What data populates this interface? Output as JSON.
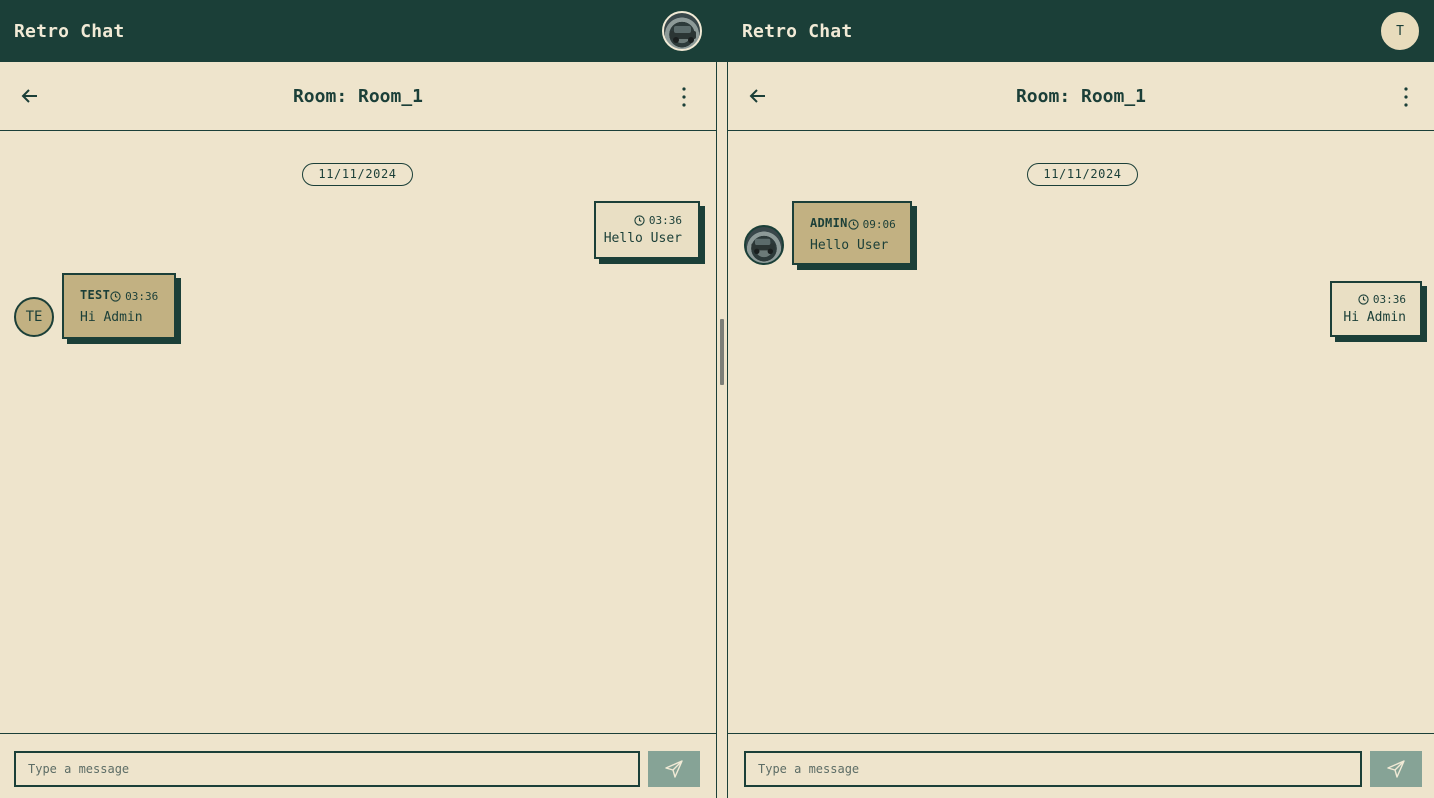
{
  "app": {
    "title": "Retro Chat"
  },
  "left_pane": {
    "header": {
      "title": "Retro Chat",
      "avatar": "user-photo-avatar"
    },
    "room": {
      "title": "Room: Room_1"
    },
    "date_label": "11/11/2024",
    "messages": [
      {
        "direction": "outgoing",
        "sender": "",
        "time": "03:36",
        "text": "Hello User"
      },
      {
        "direction": "incoming",
        "sender": "TEST",
        "avatar_initials": "TE",
        "time": "03:36",
        "text": "Hi Admin"
      }
    ],
    "composer": {
      "placeholder": "Type a message",
      "value": ""
    }
  },
  "right_pane": {
    "header": {
      "title": "Retro Chat",
      "avatar_initial": "T"
    },
    "room": {
      "title": "Room: Room_1"
    },
    "date_label": "11/11/2024",
    "messages": [
      {
        "direction": "incoming",
        "sender": "ADMIN",
        "avatar": "user-photo-avatar",
        "time": "09:06",
        "text": "Hello User"
      },
      {
        "direction": "outgoing",
        "sender": "",
        "time": "03:36",
        "text": "Hi Admin"
      }
    ],
    "composer": {
      "placeholder": "Type a message",
      "value": ""
    }
  },
  "colors": {
    "header_bg": "#1b3f38",
    "page_bg": "#eee4cc",
    "incoming_bubble": "#c2b182",
    "outgoing_bubble": "#e9dfc4",
    "send_button": "#86a396"
  }
}
